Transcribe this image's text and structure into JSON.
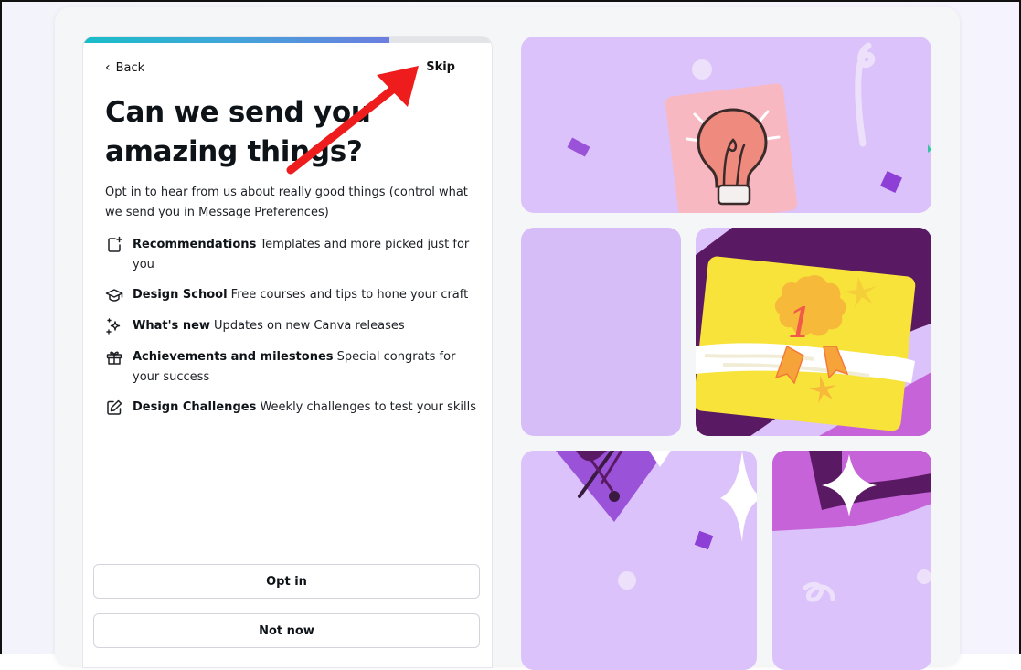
{
  "header": {
    "back_label": "Back",
    "skip_label": "Skip"
  },
  "onboarding": {
    "progress": 0.75,
    "title": "Can we send you amazing things?",
    "subtitle": "Opt in to hear from us about really good things (control what we send you in Message Preferences)",
    "features": [
      {
        "icon": "sparkle-document-icon",
        "title": "Recommendations",
        "description": "Templates and more picked just for you"
      },
      {
        "icon": "graduation-cap-icon",
        "title": "Design School",
        "description": "Free courses and tips to hone your craft"
      },
      {
        "icon": "sparkles-icon",
        "title": "What's new",
        "description": "Updates on new Canva releases"
      },
      {
        "icon": "gift-icon",
        "title": "Achievements and milestones",
        "description": "Special congrats for your success"
      },
      {
        "icon": "pencil-edit-icon",
        "title": "Design Challenges",
        "description": "Weekly challenges to test your skills"
      }
    ],
    "opt_in_label": "Opt in",
    "not_now_label": "Not now"
  },
  "illustration": {
    "badge_number": "1"
  },
  "colors": {
    "tile_purple": "#dcc2fa",
    "tile_purple_alt": "#d6b8f7",
    "dark_plum": "#5c1d62",
    "accent_yellow": "#f8e33a",
    "annotation_red": "#ee1c1c"
  }
}
